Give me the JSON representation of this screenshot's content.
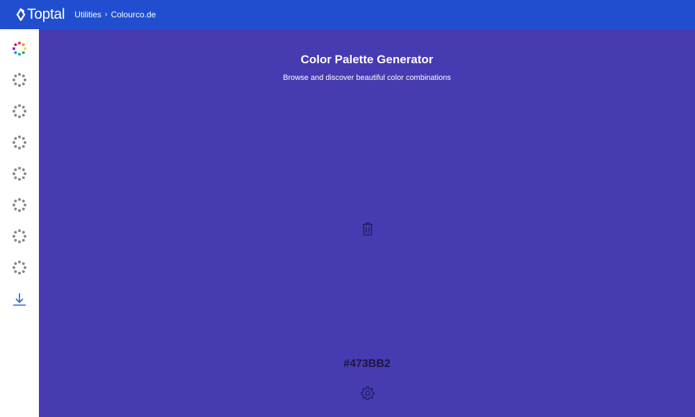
{
  "header": {
    "brand": "Toptal",
    "breadcrumb": [
      {
        "label": "Utilities"
      },
      {
        "label": "Colourco.de"
      }
    ],
    "separator": "›"
  },
  "sidebar": {
    "items": [
      {
        "name": "palette-mode-color-wheel",
        "icon": "color-wheel-icon"
      },
      {
        "name": "palette-mode-2",
        "icon": "dots-circle-icon"
      },
      {
        "name": "palette-mode-3",
        "icon": "dots-circle-icon"
      },
      {
        "name": "palette-mode-4",
        "icon": "dots-circle-icon"
      },
      {
        "name": "palette-mode-5",
        "icon": "dots-circle-icon"
      },
      {
        "name": "palette-mode-6",
        "icon": "dots-circle-icon"
      },
      {
        "name": "palette-mode-7",
        "icon": "dots-circle-icon"
      },
      {
        "name": "palette-mode-8",
        "icon": "dots-circle-icon"
      },
      {
        "name": "download",
        "icon": "download-icon"
      }
    ]
  },
  "main": {
    "title": "Color Palette Generator",
    "subtitle": "Browse and discover beautiful color combinations",
    "swatch_hex": "#473BB2",
    "trash_icon": "trash-icon",
    "settings_icon": "gear-icon"
  },
  "colors": {
    "header_bg": "#204ECF",
    "swatch_bg": "#473BB2",
    "sidebar_bg": "#FFFFFF"
  }
}
